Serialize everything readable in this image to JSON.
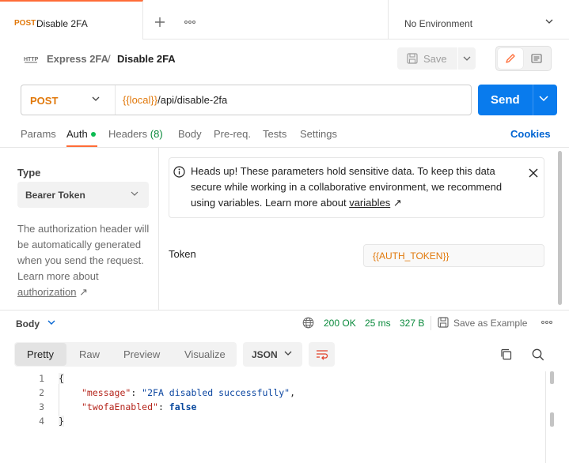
{
  "tab": {
    "method": "POST",
    "title": "Disable 2FA"
  },
  "environment": {
    "label": "No Environment"
  },
  "breadcrumb": {
    "parent": "Express 2FA",
    "separator": "/",
    "current": "Disable 2FA"
  },
  "toolbar": {
    "save_label": "Save"
  },
  "request": {
    "method": "POST",
    "url_variable": "{{local}}",
    "url_path": "/api/disable-2fa",
    "send_label": "Send"
  },
  "request_tabs": [
    {
      "label": "Params"
    },
    {
      "label": "Auth"
    },
    {
      "label": "Headers",
      "count": "(8)"
    },
    {
      "label": "Body"
    },
    {
      "label": "Pre-req."
    },
    {
      "label": "Tests"
    },
    {
      "label": "Settings"
    }
  ],
  "cookies_label": "Cookies",
  "auth": {
    "type_label": "Type",
    "type_value": "Bearer Token",
    "description": "The authorization header will be automatically generated when you send the request. Learn more about",
    "description_link": "authorization",
    "notice": "Heads up! These parameters hold sensitive data. To keep this data secure while working in a collaborative environment, we recommend using variables. Learn more about",
    "notice_link": "variables",
    "token_label": "Token",
    "token_value": "{{AUTH_TOKEN}}"
  },
  "response": {
    "body_label": "Body",
    "status": "200 OK",
    "time": "25 ms",
    "size": "327 B",
    "save_example": "Save as Example",
    "format_tabs": [
      "Pretty",
      "Raw",
      "Preview",
      "Visualize"
    ],
    "language": "JSON",
    "lines": [
      "1",
      "2",
      "3",
      "4"
    ],
    "code": {
      "open": "{",
      "key1": "\"message\"",
      "val1": "\"2FA disabled successfully\"",
      "key2": "\"twofaEnabled\"",
      "val2": "false",
      "close": "}"
    }
  },
  "colors": {
    "accent": "#ff6c37",
    "send": "#097bed",
    "method": "#e1790c",
    "success": "#0a8a3c",
    "link": "#0265d2"
  }
}
